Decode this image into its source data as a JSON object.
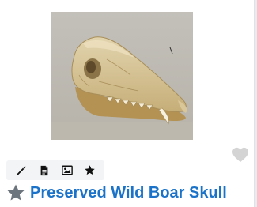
{
  "item": {
    "title": "Preserved Wild Boar Skull",
    "image_subject": "wild boar skull photo"
  },
  "toolbar": {
    "icons": [
      "pencil-icon",
      "document-icon",
      "image-icon",
      "star-icon"
    ]
  },
  "icons": {
    "favorite": "heart-icon",
    "title_marker": "star-icon"
  },
  "colors": {
    "title": "#1a73c8",
    "heart": "#d4d4d4",
    "title_star": "#6c757d",
    "toolbar_bg": "#f3f4f5",
    "toolbar_icon": "#111111"
  }
}
